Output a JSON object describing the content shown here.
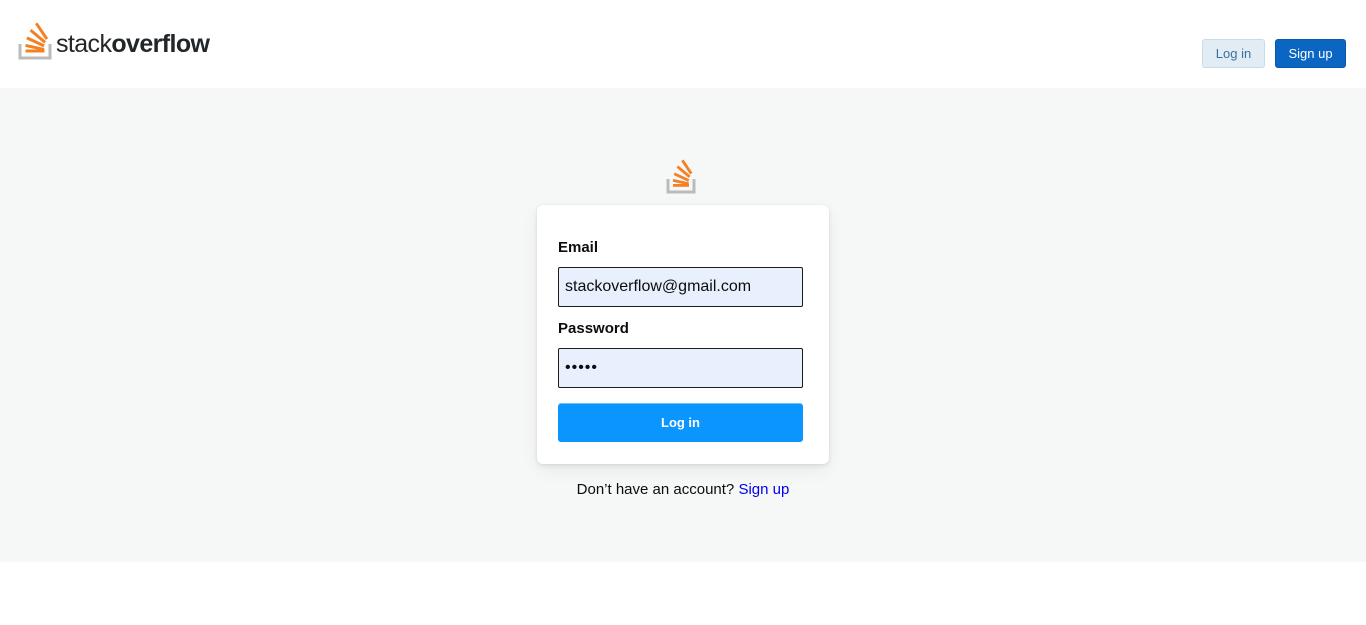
{
  "header": {
    "brand_light": "stack",
    "brand_bold": "overflow",
    "login_label": "Log in",
    "signup_label": "Sign up"
  },
  "login_form": {
    "email_label": "Email",
    "email_value": "stackoverflow@gmail.com",
    "password_label": "Password",
    "password_value": "12345",
    "submit_label": "Log in"
  },
  "footer": {
    "prompt": "Don’t have an account?",
    "signup_link": "Sign up"
  },
  "colors": {
    "brand_orange": "#f48024",
    "brand_gray": "#bcbbbb",
    "primary_blue": "#0a95ff",
    "signup_blue": "#0a66c2",
    "link_blue": "#0000ee",
    "page_bg": "#f6f7f7",
    "autofill_bg": "#e8f0fe"
  },
  "icons": {
    "logo": "stackoverflow-logo-icon"
  }
}
